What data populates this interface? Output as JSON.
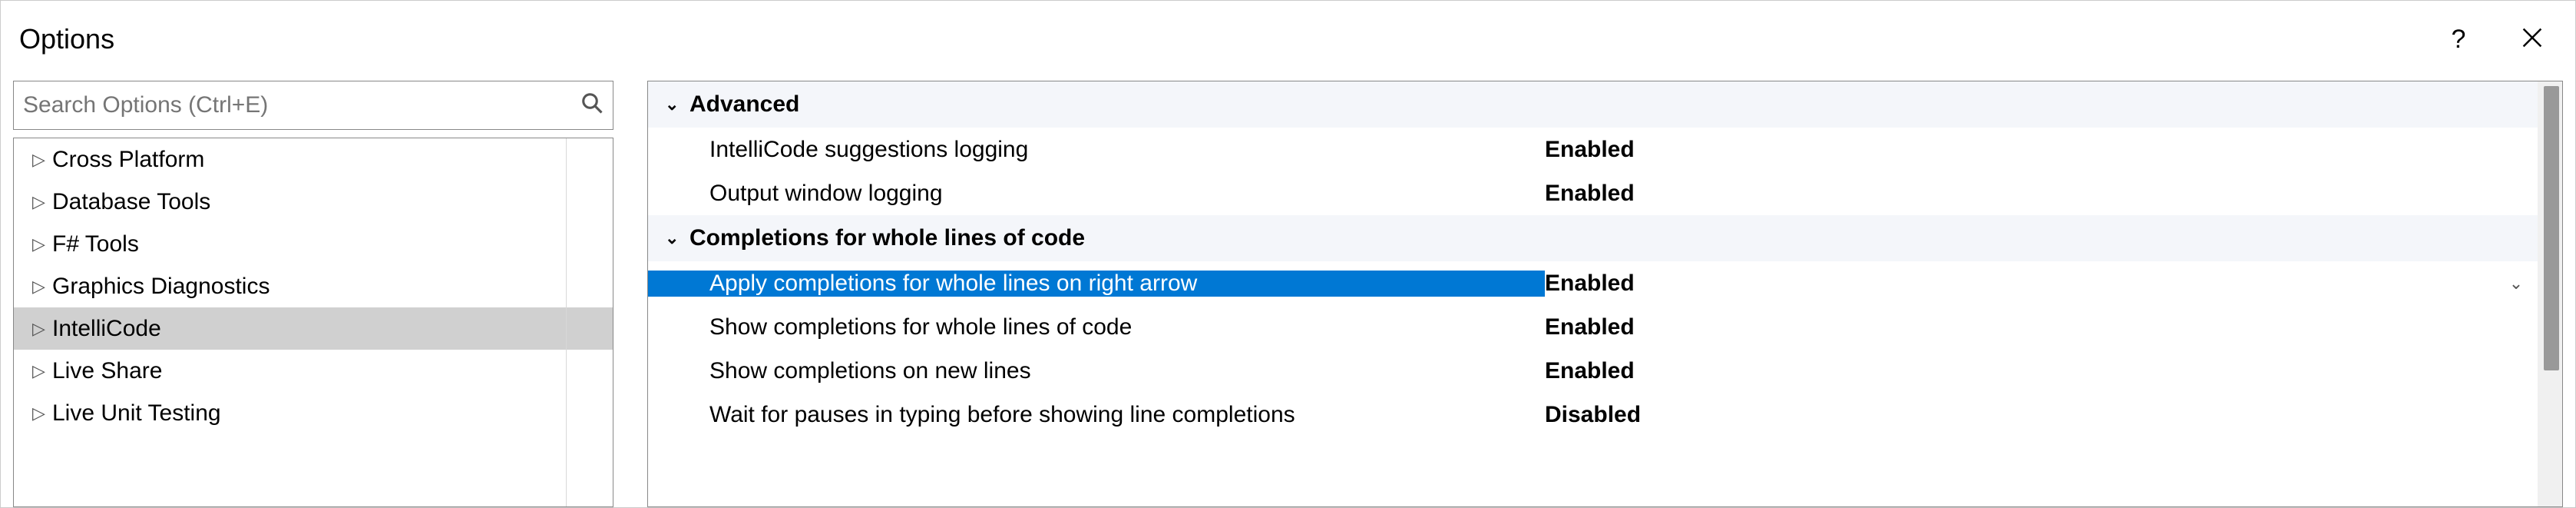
{
  "window": {
    "title": "Options",
    "help_tooltip": "?",
    "close_tooltip": "Close"
  },
  "search": {
    "placeholder": "Search Options (Ctrl+E)"
  },
  "tree": {
    "items": [
      {
        "label": "Cross Platform",
        "selected": false
      },
      {
        "label": "Database Tools",
        "selected": false
      },
      {
        "label": "F# Tools",
        "selected": false
      },
      {
        "label": "Graphics Diagnostics",
        "selected": false
      },
      {
        "label": "IntelliCode",
        "selected": true
      },
      {
        "label": "Live Share",
        "selected": false
      },
      {
        "label": "Live Unit Testing",
        "selected": false
      }
    ]
  },
  "settings": {
    "groups": [
      {
        "name": "Advanced",
        "rows": [
          {
            "label": "IntelliCode suggestions logging",
            "value": "Enabled",
            "selected": false
          },
          {
            "label": "Output window logging",
            "value": "Enabled",
            "selected": false
          }
        ]
      },
      {
        "name": "Completions for whole lines of code",
        "rows": [
          {
            "label": "Apply completions for whole lines on right arrow",
            "value": "Enabled",
            "selected": true
          },
          {
            "label": "Show completions for whole lines of code",
            "value": "Enabled",
            "selected": false
          },
          {
            "label": "Show completions on new lines",
            "value": "Enabled",
            "selected": false
          },
          {
            "label": "Wait for pauses in typing before showing line completions",
            "value": "Disabled",
            "selected": false
          }
        ]
      }
    ]
  },
  "icons": {
    "expand_right": "▷",
    "expand_down": "⌄",
    "chevron_down": "⌄"
  }
}
